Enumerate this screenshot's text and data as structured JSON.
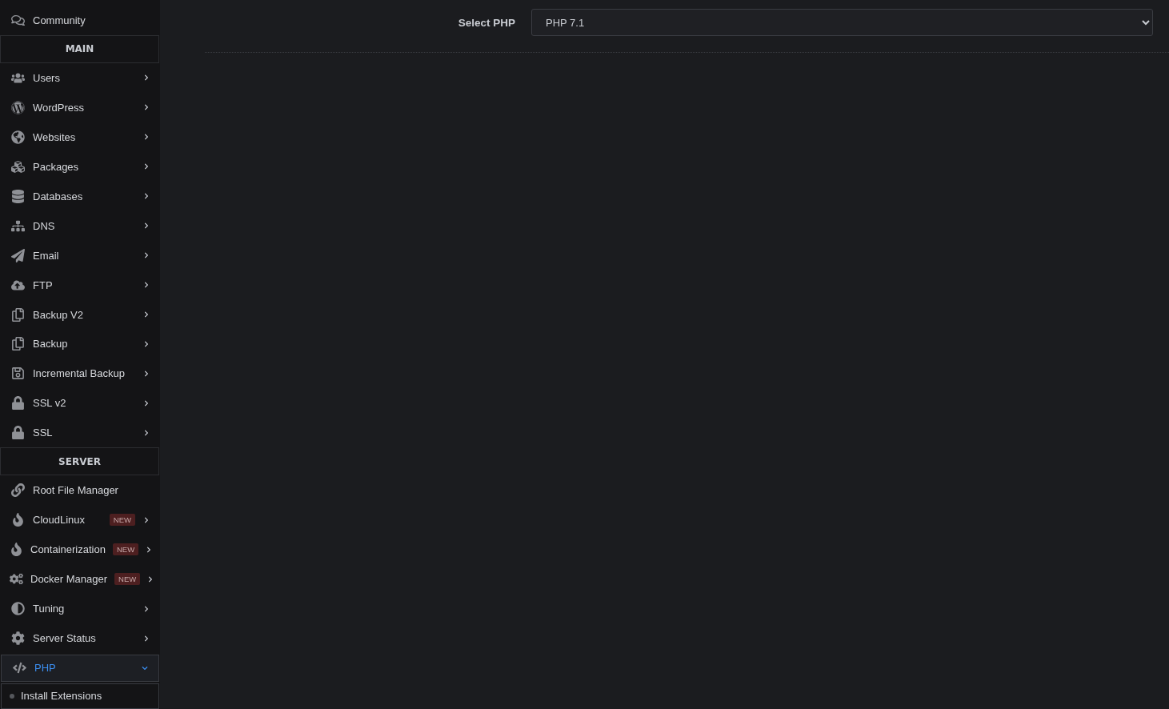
{
  "sidebar": {
    "items": [
      {
        "kind": "item",
        "label": "Community"
      },
      {
        "kind": "section",
        "label": "MAIN"
      },
      {
        "kind": "item",
        "label": "Users",
        "expanded": false
      },
      {
        "kind": "item",
        "label": "WordPress",
        "expanded": false
      },
      {
        "kind": "item",
        "label": "Websites",
        "expanded": false
      },
      {
        "kind": "item",
        "label": "Packages",
        "expanded": false
      },
      {
        "kind": "item",
        "label": "Databases",
        "expanded": false
      },
      {
        "kind": "item",
        "label": "DNS",
        "expanded": false
      },
      {
        "kind": "item",
        "label": "Email",
        "expanded": false
      },
      {
        "kind": "item",
        "label": "FTP",
        "expanded": false
      },
      {
        "kind": "item",
        "label": "Backup V2",
        "expanded": false
      },
      {
        "kind": "item",
        "label": "Backup",
        "expanded": false
      },
      {
        "kind": "item",
        "label": "Incremental Backup",
        "expanded": false
      },
      {
        "kind": "item",
        "label": "SSL v2",
        "expanded": false
      },
      {
        "kind": "item",
        "label": "SSL",
        "expanded": false
      },
      {
        "kind": "section",
        "label": "SERVER"
      },
      {
        "kind": "item",
        "label": "Root File Manager"
      },
      {
        "kind": "item",
        "label": "CloudLinux",
        "badge": "NEW",
        "expanded": false
      },
      {
        "kind": "item",
        "label": "Containerization",
        "badge": "NEW",
        "expanded": false
      },
      {
        "kind": "item",
        "label": "Docker Manager",
        "badge": "NEW",
        "expanded": false
      },
      {
        "kind": "item",
        "label": "Tuning",
        "expanded": false
      },
      {
        "kind": "item",
        "label": "Server Status",
        "expanded": false
      },
      {
        "kind": "item",
        "label": "PHP",
        "expanded": true,
        "children": [
          {
            "label": "Install Extensions"
          }
        ]
      }
    ]
  },
  "main": {
    "select_label": "Select PHP",
    "select_value": "PHP 7.1"
  }
}
